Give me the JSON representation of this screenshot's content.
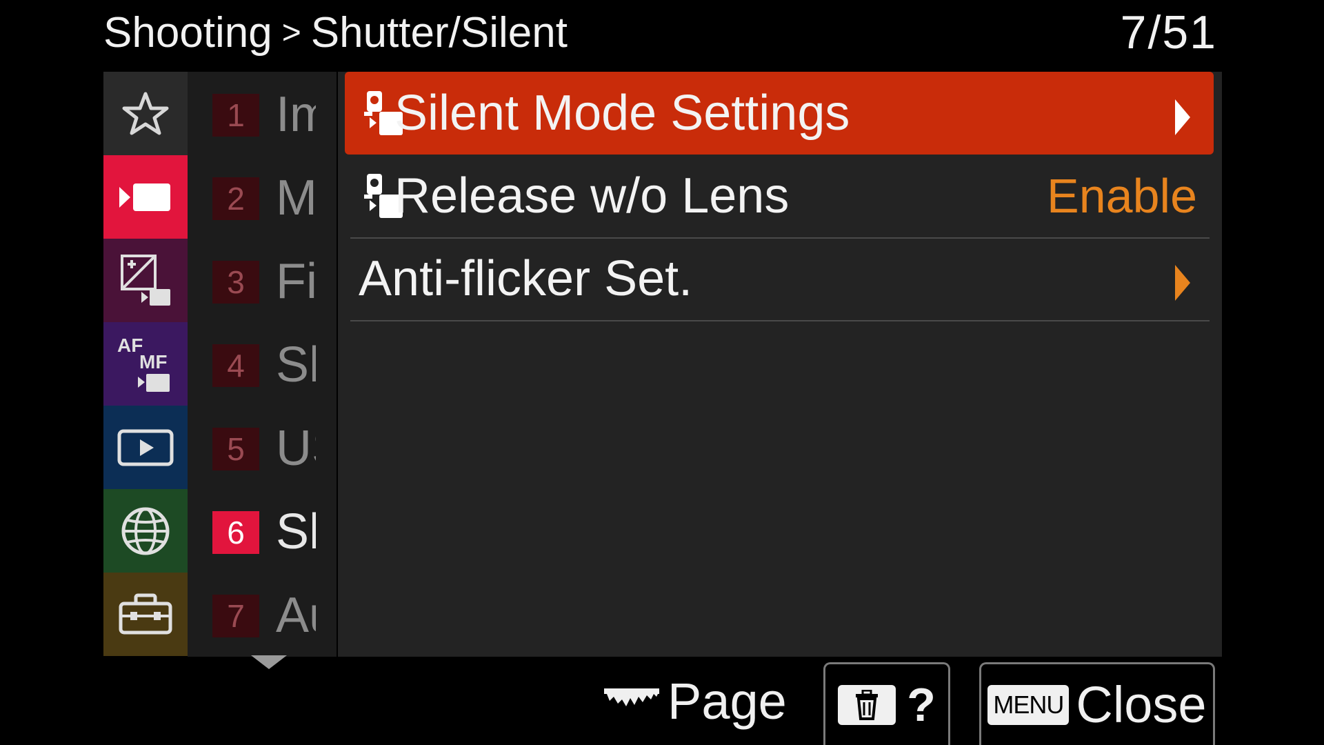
{
  "header": {
    "breadcrumb_root": "Shooting",
    "breadcrumb_separator": ">",
    "breadcrumb_current": "Shutter/Silent",
    "page_counter": "7/51"
  },
  "categories": [
    {
      "icon": "star-icon",
      "color": "#2a2a2a"
    },
    {
      "icon": "movie-camera-icon",
      "color": "#e2153d",
      "active": true
    },
    {
      "icon": "exposure-movie-icon",
      "color": "#4a1238"
    },
    {
      "icon": "af-mf-movie-icon",
      "color": "#3b1860",
      "label_af": "AF",
      "label_mf": "MF"
    },
    {
      "icon": "playback-icon",
      "color": "#0c2e55"
    },
    {
      "icon": "network-globe-icon",
      "color": "#1d4a24"
    },
    {
      "icon": "toolbox-icon",
      "color": "#4a3a12"
    }
  ],
  "pages": [
    {
      "number": "1",
      "title": "Im"
    },
    {
      "number": "2",
      "title": "M"
    },
    {
      "number": "3",
      "title": "Fi"
    },
    {
      "number": "4",
      "title": "Sh"
    },
    {
      "number": "5",
      "title": "US"
    },
    {
      "number": "6",
      "title": "Sh",
      "active": true
    },
    {
      "number": "7",
      "title": "Au"
    }
  ],
  "menu": [
    {
      "label": "Silent Mode Settings",
      "icon": "camera-movie-mode-icon",
      "value": "",
      "arrow": "white",
      "selected": true
    },
    {
      "label": "Release w/o Lens",
      "icon": "camera-movie-mode-icon",
      "value": "Enable"
    },
    {
      "label": "Anti-flicker Set.",
      "icon": "",
      "value": "",
      "arrow": "orange"
    }
  ],
  "footer": {
    "page_label": "Page",
    "help_label": "?",
    "menu_key_label": "MENU",
    "close_label": "Close"
  },
  "colors": {
    "selected_row": "#c92c0a",
    "value_text": "#e8841e",
    "active_category": "#e2153d"
  }
}
